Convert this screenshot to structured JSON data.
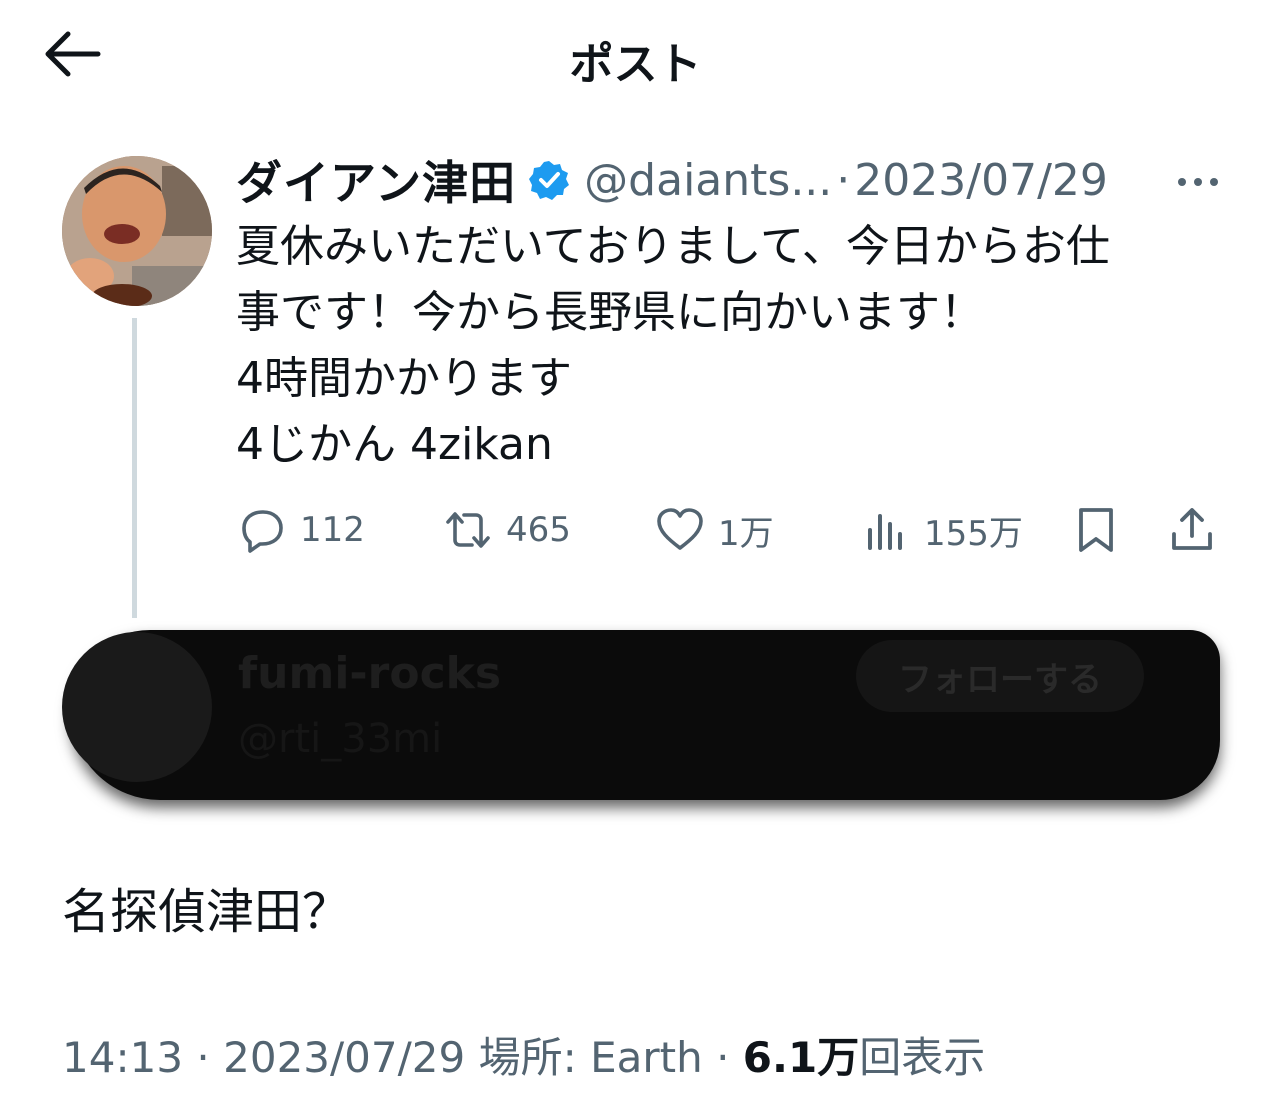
{
  "header": {
    "title": "ポスト"
  },
  "tweet": {
    "name": "ダイアン津田",
    "handle": "@daiants...",
    "separator": "·",
    "date": "2023/07/29",
    "lines": [
      "夏休みいただいておりまして、今日からお仕",
      "事です！今から長野県に向かいます！",
      "4時間かかります",
      "4じかん 4zikan"
    ],
    "stats": {
      "replies": "112",
      "retweets": "465",
      "likes": "1万",
      "views": "155万"
    }
  },
  "reply": {
    "name": "fumi-rocks",
    "handle": "@rti_33mi",
    "follow_label": "フォローする",
    "text": "名探偵津田？",
    "meta": {
      "time": "14:13",
      "sep1": "·",
      "date": "2023/07/29",
      "location_label": "場所:",
      "location": "Earth",
      "sep2": "·",
      "views_count": "6.1万",
      "views_label": "回表示"
    }
  },
  "colors": {
    "verified": "#1d9bf0",
    "secondary_text": "#536471",
    "primary_text": "#0f1419"
  }
}
